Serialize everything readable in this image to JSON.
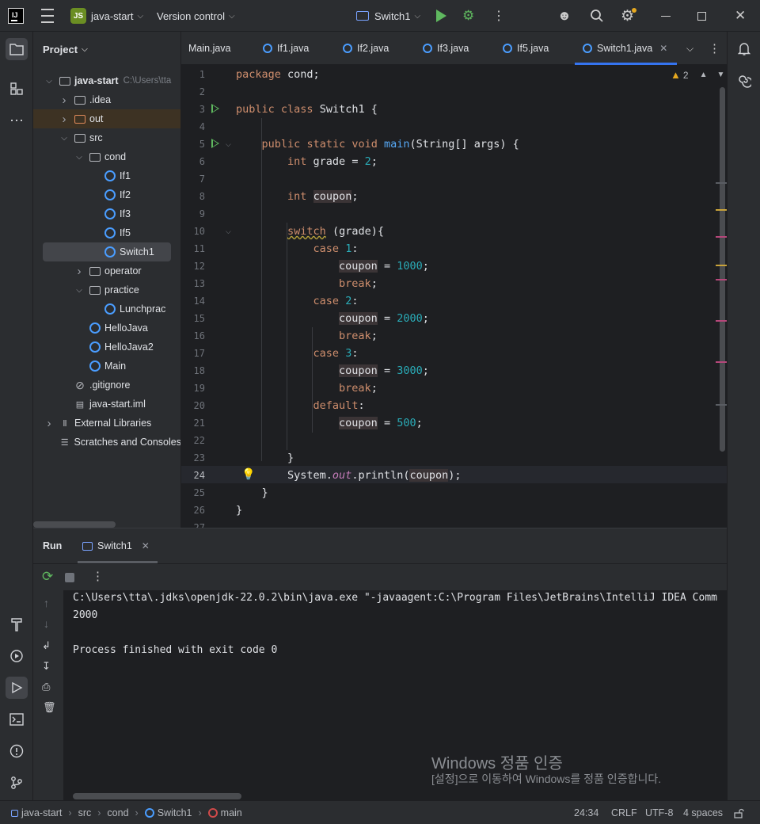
{
  "titlebar": {
    "project_badge": "JS",
    "project_name": "java-start",
    "vcs_label": "Version control",
    "run_config": "Switch1"
  },
  "project_panel": {
    "title": "Project",
    "tree": [
      {
        "label": "java-start",
        "suffix": "C:\\Users\\tta",
        "type": "module",
        "depth": 0,
        "expanded": true
      },
      {
        "label": ".idea",
        "type": "folder",
        "depth": 1,
        "expanded": false
      },
      {
        "label": "out",
        "type": "folder-excluded",
        "depth": 1,
        "expanded": false
      },
      {
        "label": "src",
        "type": "folder",
        "depth": 1,
        "expanded": true
      },
      {
        "label": "cond",
        "type": "package",
        "depth": 2,
        "expanded": true
      },
      {
        "label": "If1",
        "type": "class",
        "depth": 3
      },
      {
        "label": "If2",
        "type": "class",
        "depth": 3
      },
      {
        "label": "If3",
        "type": "class",
        "depth": 3
      },
      {
        "label": "If5",
        "type": "class",
        "depth": 3
      },
      {
        "label": "Switch1",
        "type": "class",
        "depth": 3,
        "selected": true
      },
      {
        "label": "operator",
        "type": "package",
        "depth": 2,
        "expanded": false
      },
      {
        "label": "practice",
        "type": "package",
        "depth": 2,
        "expanded": true
      },
      {
        "label": "Lunchprac",
        "type": "class",
        "depth": 3
      },
      {
        "label": "HelloJava",
        "type": "class",
        "depth": 2
      },
      {
        "label": "HelloJava2",
        "type": "class",
        "depth": 2
      },
      {
        "label": "Main",
        "type": "class",
        "depth": 2
      },
      {
        "label": ".gitignore",
        "type": "ignore",
        "depth": 1
      },
      {
        "label": "java-start.iml",
        "type": "file",
        "depth": 1
      },
      {
        "label": "External Libraries",
        "type": "libraries",
        "depth": 0,
        "expanded": false
      },
      {
        "label": "Scratches and Consoles",
        "type": "scratches",
        "depth": 0
      }
    ]
  },
  "tabs": [
    {
      "label": "Main.java",
      "active": false
    },
    {
      "label": "If1.java",
      "active": false
    },
    {
      "label": "If2.java",
      "active": false
    },
    {
      "label": "If3.java",
      "active": false
    },
    {
      "label": "If5.java",
      "active": false
    },
    {
      "label": "Switch1.java",
      "active": true
    }
  ],
  "editor": {
    "warnings_count": "2",
    "current_line": 24,
    "lines": [
      "package cond;",
      "",
      "public class Switch1 {",
      "",
      "    public static void main(String[] args) {",
      "        int grade = 2;",
      "",
      "        int coupon;",
      "",
      "        switch (grade){",
      "            case 1:",
      "                coupon = 1000;",
      "                break;",
      "            case 2:",
      "                coupon = 2000;",
      "                break;",
      "            case 3:",
      "                coupon = 3000;",
      "                break;",
      "            default:",
      "                coupon = 500;",
      "",
      "        }",
      "        System.out.println(coupon);",
      "    }",
      "}",
      ""
    ]
  },
  "run_panel": {
    "title": "Run",
    "tab_label": "Switch1",
    "console": [
      "C:\\Users\\tta\\.jdks\\openjdk-22.0.2\\bin\\java.exe \"-javaagent:C:\\Program Files\\JetBrains\\IntelliJ IDEA Comm",
      "2000",
      "",
      "Process finished with exit code 0"
    ],
    "watermark_title": "Windows 정품 인증",
    "watermark_sub": "[설정]으로 이동하여 Windows를 정품 인증합니다."
  },
  "statusbar": {
    "breadcrumbs": [
      "java-start",
      "src",
      "cond",
      "Switch1",
      "main"
    ],
    "position": "24:34",
    "line_sep": "CRLF",
    "encoding": "UTF-8",
    "indent": "4 spaces"
  }
}
